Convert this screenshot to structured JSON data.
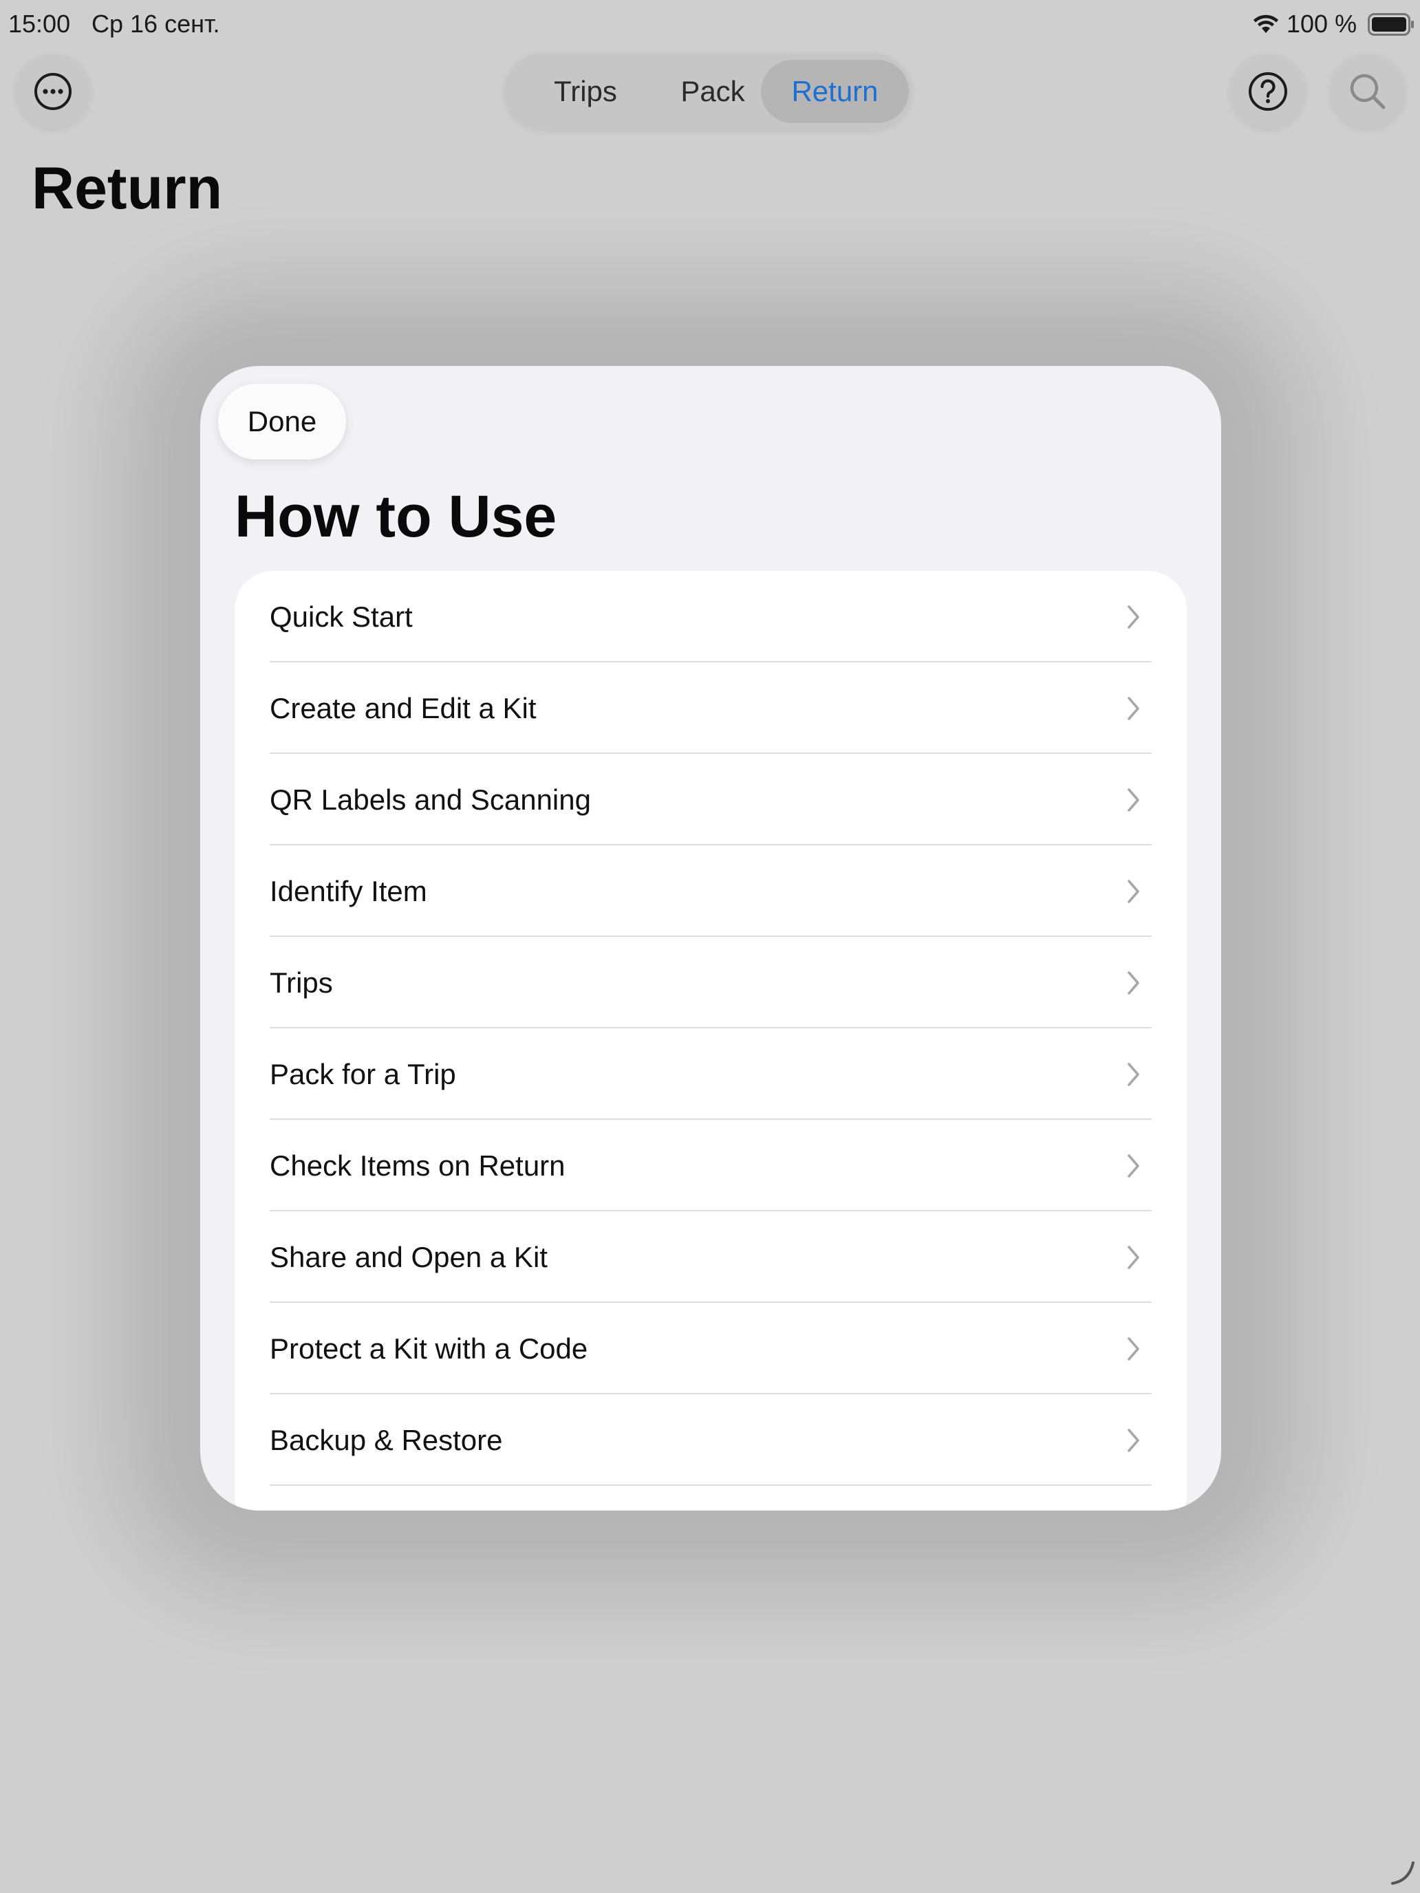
{
  "status_bar": {
    "time": "15:00",
    "date": "Ср 16 сент.",
    "battery_percent": "100 %",
    "wifi_icon": "wifi-icon",
    "battery_icon": "battery-icon"
  },
  "nav": {
    "more_icon": "ellipsis-circle-icon",
    "help_icon": "question-circle-icon",
    "search_icon": "magnifier-icon",
    "tabs": [
      {
        "label": "Trips",
        "selected": false
      },
      {
        "label": "Pack",
        "selected": false
      },
      {
        "label": "Return",
        "selected": true
      }
    ],
    "accent_color": "#1f6fd1"
  },
  "page": {
    "title": "Return"
  },
  "modal": {
    "done_label": "Done",
    "title": "How to Use",
    "items": [
      {
        "label": "Quick Start"
      },
      {
        "label": "Create and Edit a Kit"
      },
      {
        "label": "QR Labels and Scanning"
      },
      {
        "label": "Identify Item"
      },
      {
        "label": "Trips"
      },
      {
        "label": "Pack for a Trip"
      },
      {
        "label": "Check Items on Return"
      },
      {
        "label": "Share and Open a Kit"
      },
      {
        "label": "Protect a Kit with a Code"
      },
      {
        "label": "Backup & Restore"
      }
    ],
    "item_icon": "chevron-right-icon"
  }
}
